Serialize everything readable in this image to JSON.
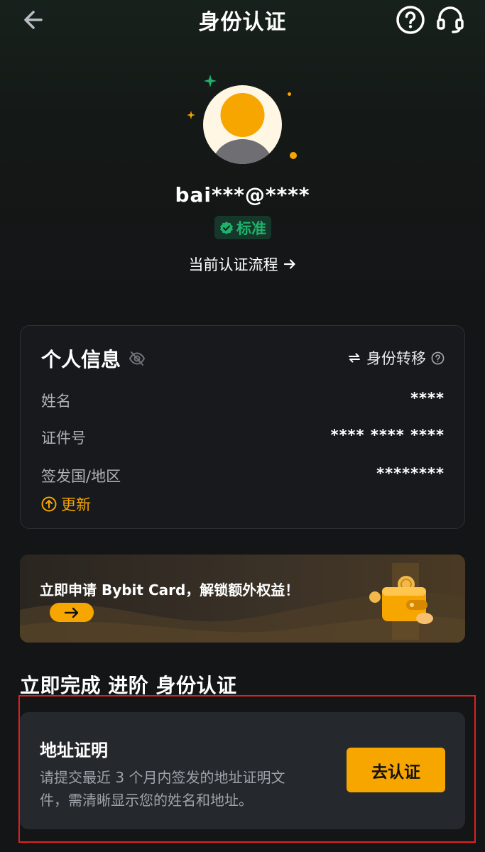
{
  "header": {
    "title": "身份认证",
    "back_icon": "arrow-left-icon",
    "help_icon": "question-circle-icon",
    "support_icon": "headset-icon"
  },
  "profile": {
    "username": "bai***@****",
    "level_badge": "标准",
    "flow_link": "当前认证流程"
  },
  "personal_info": {
    "title": "个人信息",
    "transfer_label": "身份转移",
    "rows": [
      {
        "label": "姓名",
        "value": "****"
      },
      {
        "label": "证件号",
        "value": "**** **** ****"
      },
      {
        "label": "签发国/地区",
        "value": "********"
      }
    ],
    "update_label": "更新"
  },
  "banner": {
    "text": "立即申请 Bybit Card，解锁额外权益！"
  },
  "advanced": {
    "section_title": "立即完成 进阶 身份认证",
    "card_title": "地址证明",
    "card_desc": "请提交最近 3 个月内签发的地址证明文件，需清晰显示您的姓名和地址。",
    "button_label": "去认证"
  },
  "colors": {
    "accent": "#f7a600",
    "success": "#20b26c",
    "highlight_border": "#e02020"
  }
}
